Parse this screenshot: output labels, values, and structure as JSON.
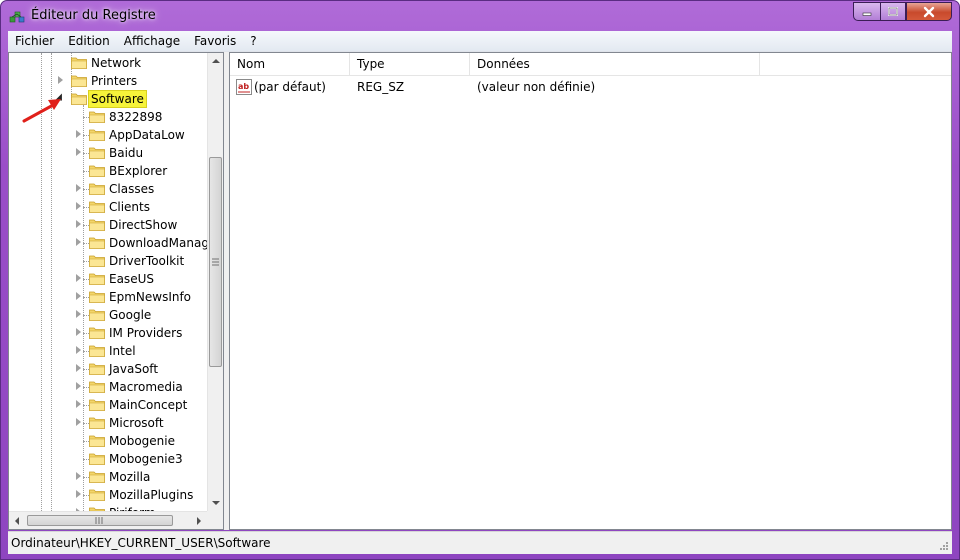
{
  "window": {
    "title": "Éditeur du Registre",
    "accent_color": "#9a4ec8",
    "app_icon": "registry-editor-icon",
    "controls": [
      "minimize-icon",
      "maximize-icon",
      "close-icon"
    ]
  },
  "menu": {
    "items": [
      "Fichier",
      "Edition",
      "Affichage",
      "Favoris",
      "?"
    ]
  },
  "tree": {
    "icon": "folder-icon",
    "parent_items": [
      {
        "label": "Network",
        "expandable": false
      },
      {
        "label": "Printers",
        "expandable": true
      },
      {
        "label": "Software",
        "expandable": true,
        "expanded": true,
        "selected": true
      }
    ],
    "children": [
      {
        "label": "8322898",
        "expandable": false
      },
      {
        "label": "AppDataLow",
        "expandable": true
      },
      {
        "label": "Baidu",
        "expandable": true
      },
      {
        "label": "BExplorer",
        "expandable": false
      },
      {
        "label": "Classes",
        "expandable": true
      },
      {
        "label": "Clients",
        "expandable": true
      },
      {
        "label": "DirectShow",
        "expandable": true
      },
      {
        "label": "DownloadManage",
        "expandable": true
      },
      {
        "label": "DriverToolkit",
        "expandable": false
      },
      {
        "label": "EaseUS",
        "expandable": true
      },
      {
        "label": "EpmNewsInfo",
        "expandable": true
      },
      {
        "label": "Google",
        "expandable": true
      },
      {
        "label": "IM Providers",
        "expandable": true
      },
      {
        "label": "Intel",
        "expandable": true
      },
      {
        "label": "JavaSoft",
        "expandable": true
      },
      {
        "label": "Macromedia",
        "expandable": true
      },
      {
        "label": "MainConcept",
        "expandable": true
      },
      {
        "label": "Microsoft",
        "expandable": true
      },
      {
        "label": "Mobogenie",
        "expandable": false
      },
      {
        "label": "Mobogenie3",
        "expandable": false
      },
      {
        "label": "Mozilla",
        "expandable": true
      },
      {
        "label": "MozillaPlugins",
        "expandable": true
      },
      {
        "label": "Piriform",
        "expandable": true
      }
    ],
    "highlight_color": "#f6f33a",
    "annotation_arrow_color": "#e0201a"
  },
  "list": {
    "columns": [
      "Nom",
      "Type",
      "Données"
    ],
    "rows": [
      {
        "icon": "string-value-icon",
        "name": "(par défaut)",
        "type": "REG_SZ",
        "data": "(valeur non définie)"
      }
    ]
  },
  "status": {
    "path": "Ordinateur\\HKEY_CURRENT_USER\\Software"
  }
}
